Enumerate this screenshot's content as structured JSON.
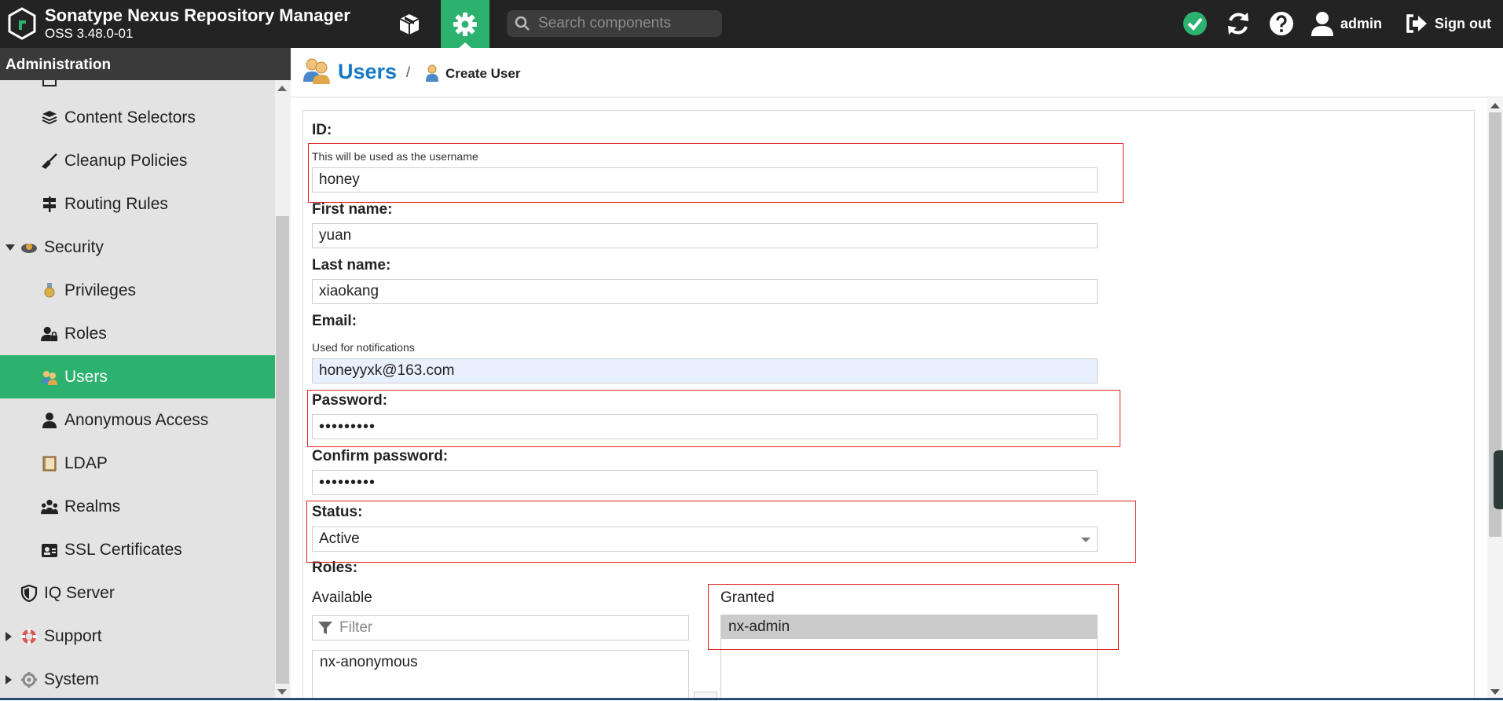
{
  "header": {
    "app_title": "Sonatype Nexus Repository Manager",
    "version": "OSS 3.48.0-01",
    "search_placeholder": "Search components",
    "username": "admin",
    "signout_label": "Sign out",
    "accent_color": "#2cb26e"
  },
  "sidebar": {
    "title": "Administration",
    "items": [
      {
        "label": "Content Selectors",
        "icon": "layers-icon"
      },
      {
        "label": "Cleanup Policies",
        "icon": "broom-icon"
      },
      {
        "label": "Routing Rules",
        "icon": "signpost-icon"
      },
      {
        "label": "Security",
        "icon": "security-icon",
        "expanded": true
      },
      {
        "label": "Privileges",
        "icon": "medal-icon"
      },
      {
        "label": "Roles",
        "icon": "user-lock-icon"
      },
      {
        "label": "Users",
        "icon": "users-icon",
        "active": true
      },
      {
        "label": "Anonymous Access",
        "icon": "user-icon"
      },
      {
        "label": "LDAP",
        "icon": "book-icon"
      },
      {
        "label": "Realms",
        "icon": "users-group-icon"
      },
      {
        "label": "SSL Certificates",
        "icon": "id-card-icon"
      },
      {
        "label": "IQ Server",
        "icon": "shield-icon"
      },
      {
        "label": "Support",
        "icon": "lifebuoy-icon",
        "expanded": false
      },
      {
        "label": "System",
        "icon": "gear-icon",
        "expanded": false
      }
    ]
  },
  "breadcrumb": {
    "section": "Users",
    "separator": "/",
    "page": "Create User"
  },
  "form": {
    "id": {
      "label": "ID:",
      "help": "This will be used as the username",
      "value": "honey"
    },
    "first_name": {
      "label": "First name:",
      "value": "yuan"
    },
    "last_name": {
      "label": "Last name:",
      "value": "xiaokang"
    },
    "email": {
      "label": "Email:",
      "help": "Used for notifications",
      "value": "honeyyxk@163.com"
    },
    "password": {
      "label": "Password:",
      "value": "•••••••••"
    },
    "confirm_password": {
      "label": "Confirm password:",
      "value": "•••••••••"
    },
    "status": {
      "label": "Status:",
      "value": "Active"
    },
    "roles": {
      "label": "Roles:",
      "available_label": "Available",
      "filter_placeholder": "Filter",
      "available": [
        "nx-anonymous"
      ],
      "granted_label": "Granted",
      "granted": [
        "nx-admin"
      ]
    }
  },
  "colors": {
    "link_blue": "#1679c4",
    "highlight_red": "#e02020",
    "header_bg": "#232323"
  }
}
